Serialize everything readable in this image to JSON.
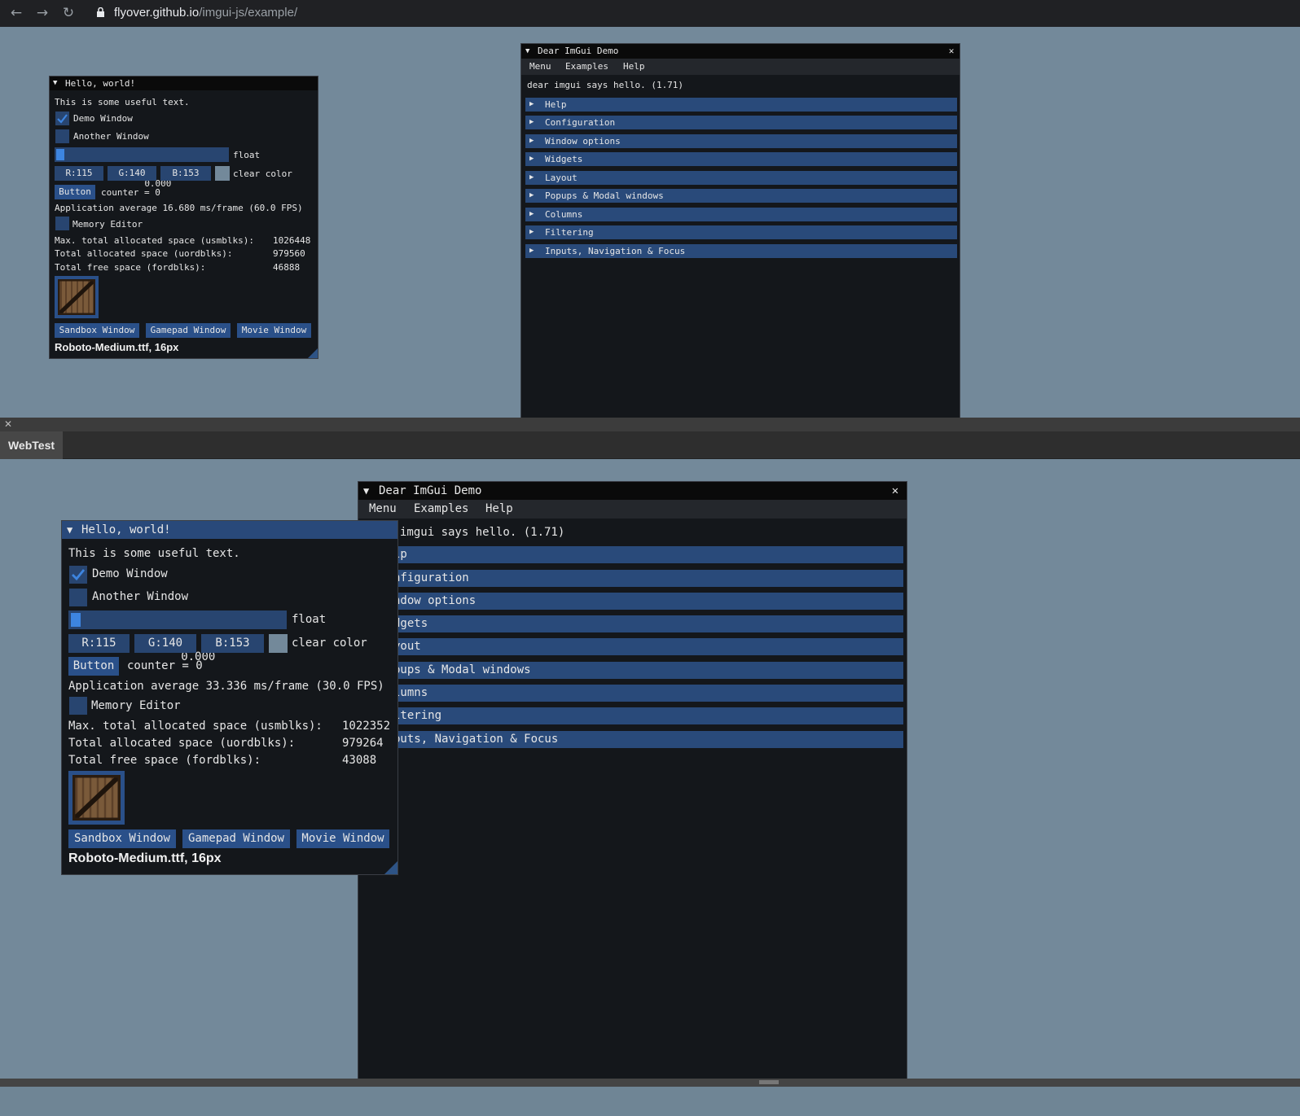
{
  "browser": {
    "back_icon": "arrow-left-icon",
    "forward_icon": "arrow-right-icon",
    "reload_icon": "reload-icon",
    "url_host": "flyover.github.io",
    "url_path": "/imgui-js/example/"
  },
  "colors": {
    "canvas_bg": "#73899a",
    "window_bg": "#14171b",
    "frame_bg": "#284570",
    "button_bg": "#2a5089",
    "header_bg": "#294a7a",
    "title_active": "#29497a",
    "checkmark": "#3d85e0"
  },
  "top": {
    "hello": {
      "title": "Hello, world!",
      "useful_text": "This is some useful text.",
      "demo_window_label": "Demo Window",
      "demo_window_checked": true,
      "another_window_label": "Another Window",
      "another_window_checked": false,
      "slider_value": "0.000",
      "slider_label": "float",
      "r": "R:115",
      "g": "G:140",
      "b": "B:153",
      "clear_color_label": "clear color",
      "button_label": "Button",
      "counter": "counter = 0",
      "app_average": "Application average 16.680 ms/frame (60.0 FPS)",
      "memory_editor_label": "Memory Editor",
      "mem_max_label": "Max. total allocated space (usmblks):",
      "mem_max_value": "1026448",
      "mem_alloc_label": "Total allocated space (uordblks):",
      "mem_alloc_value": "979560",
      "mem_free_label": "Total free space (fordblks):",
      "mem_free_value": "46888",
      "sandbox_button": "Sandbox Window",
      "gamepad_button": "Gamepad Window",
      "movie_button": "Movie Window",
      "font_label": "Roboto-Medium.ttf, 16px"
    },
    "demo": {
      "title": "Dear ImGui Demo",
      "menu": [
        "Menu",
        "Examples",
        "Help"
      ],
      "hello_text": "dear imgui says hello. (1.71)",
      "headers": [
        "Help",
        "Configuration",
        "Window options",
        "Widgets",
        "Layout",
        "Popups & Modal windows",
        "Columns",
        "Filtering",
        "Inputs, Navigation & Focus"
      ]
    }
  },
  "devtools": {
    "close_icon": "close-icon",
    "tab_label": "WebTest"
  },
  "bottom": {
    "hello": {
      "title": "Hello, world!",
      "useful_text": "This is some useful text.",
      "demo_window_label": "Demo Window",
      "demo_window_checked": true,
      "another_window_label": "Another Window",
      "another_window_checked": false,
      "slider_value": "0.000",
      "slider_label": "float",
      "r": "R:115",
      "g": "G:140",
      "b": "B:153",
      "clear_color_label": "clear color",
      "button_label": "Button",
      "counter": "counter = 0",
      "app_average": "Application average 33.336 ms/frame (30.0 FPS)",
      "memory_editor_label": "Memory Editor",
      "mem_max_label": "Max. total allocated space (usmblks):",
      "mem_max_value": "1022352",
      "mem_alloc_label": "Total allocated space (uordblks):",
      "mem_alloc_value": "979264",
      "mem_free_label": "Total free space (fordblks):",
      "mem_free_value": "43088",
      "sandbox_button": "Sandbox Window",
      "gamepad_button": "Gamepad Window",
      "movie_button": "Movie Window",
      "font_label": "Roboto-Medium.ttf, 16px"
    },
    "demo": {
      "title": "Dear ImGui Demo",
      "menu": [
        "Menu",
        "Examples",
        "Help"
      ],
      "hello_text": "imgui says hello. (1.71)",
      "headers": [
        "lp",
        "nfiguration",
        "ndow options",
        "dgets",
        "yout",
        "pups & Modal windows",
        "lumns",
        "ltering",
        "puts, Navigation & Focus"
      ]
    }
  }
}
